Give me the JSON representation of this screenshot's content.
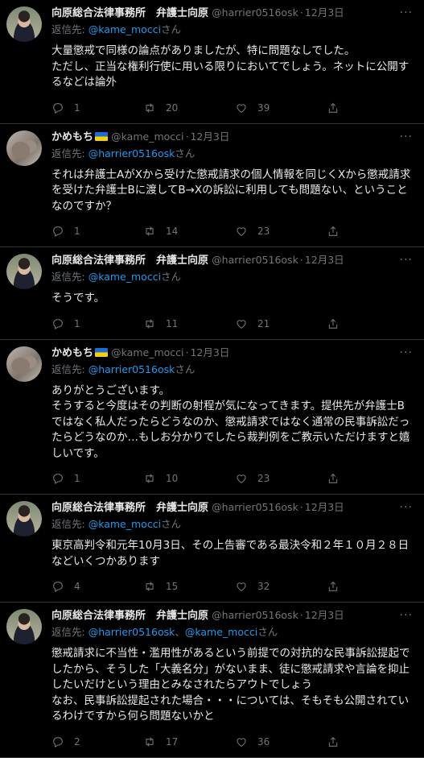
{
  "tweets": [
    {
      "name": "向原総合法律事務所　弁護士向原",
      "handle": "@harrier0516osk",
      "time": "12月3日",
      "replyto_label": "返信先:",
      "replyto": "@kame_mocci",
      "replyto2": "",
      "replyto_suffix": "さん",
      "avatar": "lawyer",
      "flag": false,
      "text": "大量懲戒で同様の論点がありましたが、特に問題なしでした。\nただし、正当な権利行使に用いる限りにおいてでしょう。ネットに公開するなどは論外",
      "replies": "1",
      "retweets": "20",
      "likes": "39"
    },
    {
      "name": "かめもち",
      "handle": "@kame_mocci",
      "time": "12月3日",
      "replyto_label": "返信先:",
      "replyto": "@harrier0516osk",
      "replyto2": "",
      "replyto_suffix": "さん",
      "avatar": "kame",
      "flag": true,
      "text": "それは弁護士AがXから受けた懲戒請求の個人情報を同じくXから懲戒請求を受けた弁護士Bに渡してB→Xの訴訟に利用しても問題ない、ということなのですか？",
      "replies": "1",
      "retweets": "14",
      "likes": "23"
    },
    {
      "name": "向原総合法律事務所　弁護士向原",
      "handle": "@harrier0516osk",
      "time": "12月3日",
      "replyto_label": "返信先:",
      "replyto": "@kame_mocci",
      "replyto2": "",
      "replyto_suffix": "さん",
      "avatar": "lawyer",
      "flag": false,
      "text": "そうです。",
      "replies": "1",
      "retweets": "11",
      "likes": "21"
    },
    {
      "name": "かめもち",
      "handle": "@kame_mocci",
      "time": "12月3日",
      "replyto_label": "返信先:",
      "replyto": "@harrier0516osk",
      "replyto2": "",
      "replyto_suffix": "さん",
      "avatar": "kame",
      "flag": true,
      "text": "ありがとうございます。\nそうすると今度はその判断の射程が気になってきます。提供先が弁護士Bではなく私人だったらどうなのか、懲戒請求ではなく通常の民事訴訟だったらどうなのか…もしお分かりでしたら裁判例をご教示いただけますと嬉しいです。",
      "replies": "1",
      "retweets": "10",
      "likes": "23"
    },
    {
      "name": "向原総合法律事務所　弁護士向原",
      "handle": "@harrier0516osk",
      "time": "12月3日",
      "replyto_label": "返信先:",
      "replyto": "@kame_mocci",
      "replyto2": "",
      "replyto_suffix": "さん",
      "avatar": "lawyer",
      "flag": false,
      "text": "東京高判令和元年10月3日、その上告審である最決令和２年１０月２８日などいくつかあります",
      "replies": "4",
      "retweets": "15",
      "likes": "32"
    },
    {
      "name": "向原総合法律事務所　弁護士向原",
      "handle": "@harrier0516osk",
      "time": "12月3日",
      "replyto_label": "返信先:",
      "replyto": "@harrier0516osk",
      "replyto2": "@kame_mocci",
      "replyto_suffix": "さん",
      "avatar": "lawyer",
      "flag": false,
      "text": "懲戒請求に不当性・濫用性があるという前提での対抗的な民事訴訟提起でしたから、そうした「大義名分」がないまま、徒に懲戒請求や言論を抑止したいだけという理由とみなされたらアウトでしょう\nなお、民事訴訟提起された場合・・・については、そもそも公開されているわけですから何ら問題ないかと",
      "replies": "2",
      "retweets": "17",
      "likes": "36"
    }
  ],
  "more_label": "···",
  "colors": {
    "link": "#1d9bf0",
    "muted": "#71767b",
    "text": "#e7e9ea",
    "bg": "#000000"
  },
  "icons": [
    "reply-icon",
    "retweet-icon",
    "like-icon",
    "share-icon"
  ]
}
